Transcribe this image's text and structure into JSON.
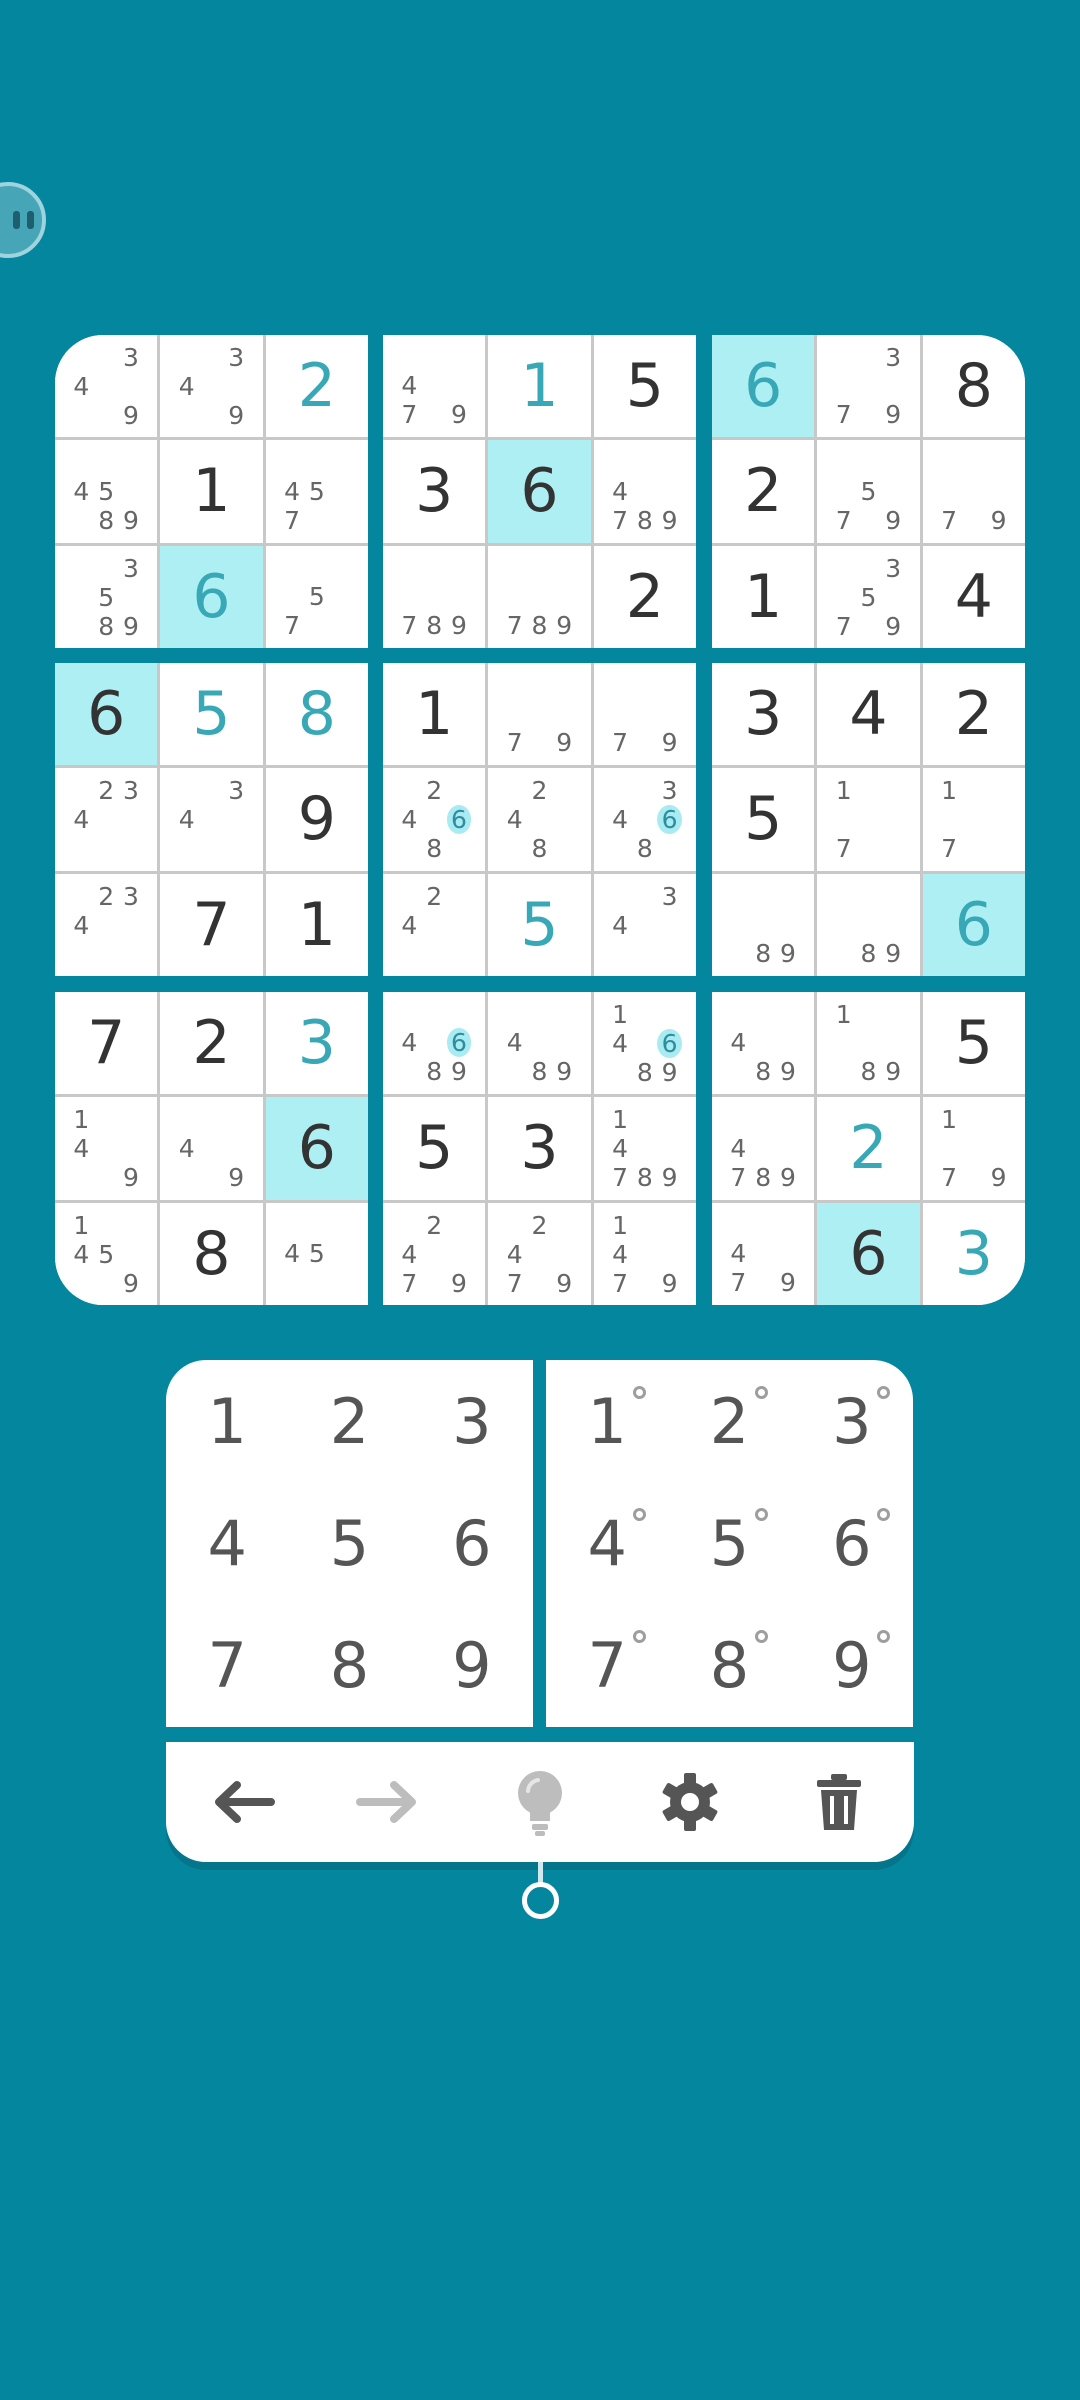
{
  "board": {
    "boxes": [
      [
        {
          "notes": [
            3,
            4,
            9
          ]
        },
        {
          "notes": [
            3,
            4,
            9
          ]
        },
        {
          "v": "2",
          "user": true
        },
        {
          "notes": [
            4,
            5,
            8,
            9
          ]
        },
        {
          "v": "1"
        },
        {
          "notes": [
            4,
            5,
            7
          ]
        },
        {
          "notes": [
            3,
            5,
            8,
            9
          ]
        },
        {
          "v": "6",
          "user": true,
          "hl": true
        },
        {
          "notes": [
            5,
            7
          ]
        }
      ],
      [
        {
          "notes": [
            4,
            7,
            9
          ]
        },
        {
          "v": "1",
          "user": true
        },
        {
          "v": "5"
        },
        {
          "v": "3"
        },
        {
          "v": "6",
          "hl": true
        },
        {
          "notes": [
            4,
            7,
            8,
            9
          ]
        },
        {
          "notes": [
            7,
            8,
            9
          ]
        },
        {
          "notes": [
            7,
            8,
            9
          ]
        },
        {
          "v": "2"
        }
      ],
      [
        {
          "v": "6",
          "user": true,
          "hl": true
        },
        {
          "notes": [
            3,
            7,
            9
          ]
        },
        {
          "v": "8"
        },
        {
          "v": "2"
        },
        {
          "notes": [
            5,
            7,
            9
          ]
        },
        {
          "notes": [
            7,
            9
          ]
        },
        {
          "v": "1"
        },
        {
          "notes": [
            3,
            5,
            7,
            9
          ]
        },
        {
          "v": "4"
        }
      ],
      [
        {
          "v": "6",
          "hl": true
        },
        {
          "v": "5",
          "user": true
        },
        {
          "v": "8",
          "user": true
        },
        {
          "notes": [
            2,
            3,
            4
          ]
        },
        {
          "notes": [
            3,
            4
          ]
        },
        {
          "v": "9"
        },
        {
          "notes": [
            2,
            3,
            4
          ]
        },
        {
          "v": "7"
        },
        {
          "v": "1"
        }
      ],
      [
        {
          "v": "1"
        },
        {
          "notes": [
            7,
            9
          ]
        },
        {
          "notes": [
            7,
            9
          ]
        },
        {
          "notes": [
            2,
            4,
            6,
            8
          ],
          "mark": 6
        },
        {
          "notes": [
            2,
            4,
            8
          ]
        },
        {
          "notes": [
            3,
            4,
            6,
            8
          ],
          "mark": 6
        },
        {
          "notes": [
            2,
            4
          ]
        },
        {
          "v": "5",
          "user": true
        },
        {
          "notes": [
            3,
            4
          ]
        }
      ],
      [
        {
          "v": "3"
        },
        {
          "v": "4"
        },
        {
          "v": "2"
        },
        {
          "v": "5"
        },
        {
          "notes": [
            1,
            7
          ]
        },
        {
          "notes": [
            1,
            7
          ]
        },
        {
          "notes": [
            8,
            9
          ]
        },
        {
          "notes": [
            8,
            9
          ]
        },
        {
          "v": "6",
          "user": true,
          "hl": true
        }
      ],
      [
        {
          "v": "7"
        },
        {
          "v": "2"
        },
        {
          "v": "3",
          "user": true
        },
        {
          "notes": [
            1,
            4,
            9
          ]
        },
        {
          "notes": [
            4,
            9
          ]
        },
        {
          "v": "6",
          "hl": true
        },
        {
          "notes": [
            1,
            4,
            5,
            9
          ]
        },
        {
          "v": "8"
        },
        {
          "notes": [
            4,
            5
          ]
        }
      ],
      [
        {
          "notes": [
            4,
            6,
            8,
            9
          ],
          "mark": 6
        },
        {
          "notes": [
            4,
            8,
            9
          ]
        },
        {
          "notes": [
            1,
            4,
            6,
            8,
            9
          ],
          "mark": 6
        },
        {
          "v": "5"
        },
        {
          "v": "3"
        },
        {
          "notes": [
            1,
            4,
            7,
            8,
            9
          ]
        },
        {
          "notes": [
            2,
            4,
            7,
            9
          ]
        },
        {
          "notes": [
            2,
            4,
            7,
            9
          ]
        },
        {
          "notes": [
            1,
            4,
            7,
            9
          ]
        }
      ],
      [
        {
          "notes": [
            4,
            8,
            9
          ]
        },
        {
          "notes": [
            1,
            8,
            9
          ]
        },
        {
          "v": "5"
        },
        {
          "notes": [
            4,
            7,
            8,
            9
          ]
        },
        {
          "v": "2",
          "user": true
        },
        {
          "notes": [
            1,
            7,
            9
          ]
        },
        {
          "notes": [
            4,
            7,
            9
          ]
        },
        {
          "v": "6",
          "hl": true
        },
        {
          "v": "3",
          "user": true
        }
      ]
    ]
  },
  "numpad": {
    "keys": [
      "1",
      "2",
      "3",
      "4",
      "5",
      "6",
      "7",
      "8",
      "9"
    ]
  },
  "notepad": {
    "keys": [
      "1",
      "2",
      "3",
      "4",
      "5",
      "6",
      "7",
      "8",
      "9"
    ]
  },
  "toolbar": {
    "icons": [
      "undo-arrow-icon",
      "redo-arrow-icon",
      "hint-bulb-icon",
      "gear-icon",
      "trash-icon"
    ],
    "colors": {
      "active": "#555555",
      "disabled": "#BDBDBD"
    }
  },
  "colors": {
    "background": "#05869F",
    "user_digit": "#38A8B7",
    "given_digit": "#333333",
    "highlight": "#AEEFF4"
  }
}
